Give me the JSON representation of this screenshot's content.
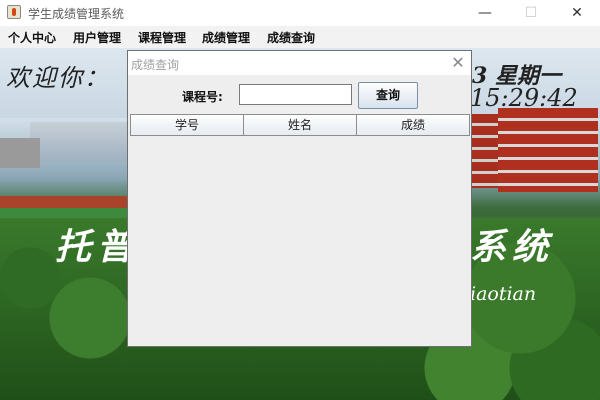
{
  "window": {
    "title": "学生成绩管理系统",
    "min_glyph": "—",
    "max_glyph": "☐",
    "close_glyph": "✕",
    "icon": "java-cup-icon"
  },
  "menu": {
    "items": [
      {
        "label": "个人中心"
      },
      {
        "label": "用户管理"
      },
      {
        "label": "课程管理"
      },
      {
        "label": "成绩管理"
      },
      {
        "label": "成绩查询"
      }
    ]
  },
  "background": {
    "welcome": "欢迎你：",
    "date": "3 星期一",
    "time": "15:29:42",
    "system_title_left": "托普",
    "system_title_right": "系统",
    "author": "iaotian"
  },
  "dialog": {
    "title": "成绩查询",
    "close_glyph": "✕",
    "course_label": "课程号:",
    "course_value": "",
    "query_button": "查询",
    "table": {
      "columns": [
        "学号",
        "姓名",
        "成绩"
      ],
      "rows": []
    }
  },
  "colors": {
    "accent_button_gradient": "#d7e2ee",
    "dialog_bg": "#eeeeee"
  }
}
